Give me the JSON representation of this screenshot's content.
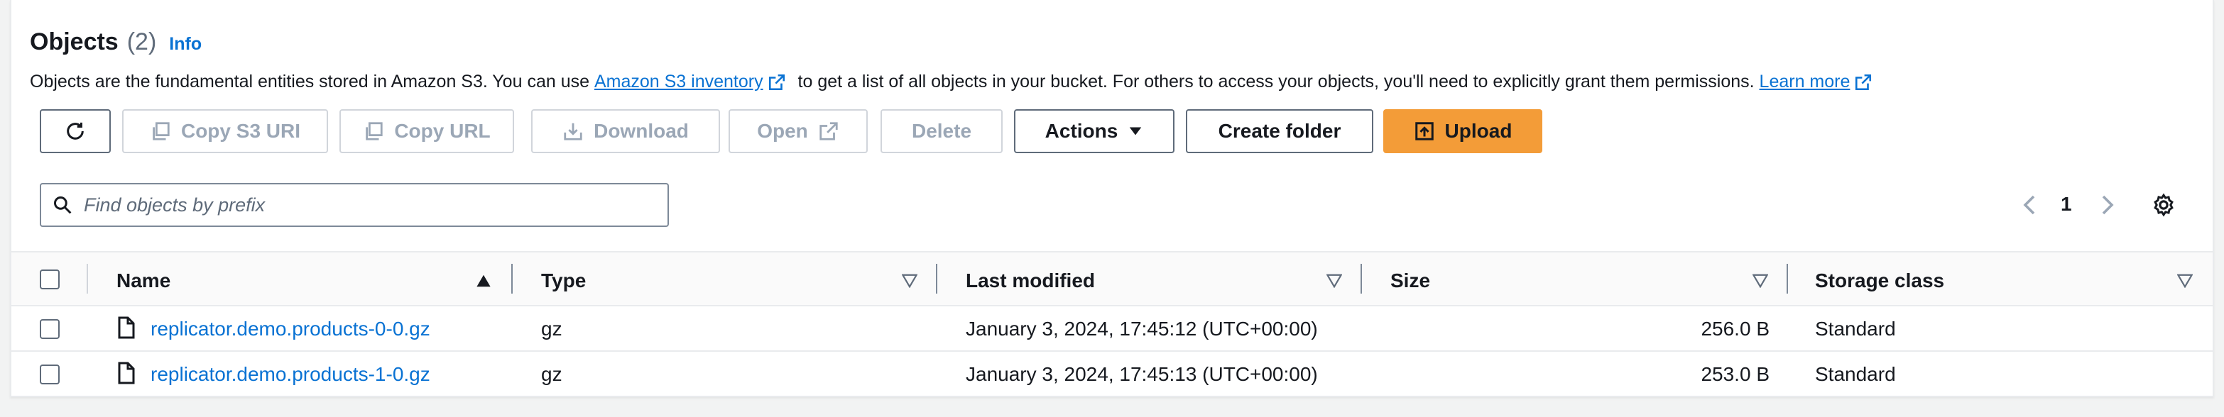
{
  "header": {
    "title": "Objects",
    "count": "(2)",
    "info": "Info"
  },
  "description": {
    "text_before": "Objects are the fundamental entities stored in Amazon S3. You can use ",
    "link_inventory": "Amazon S3 inventory",
    "text_middle": " to get a list of all objects in your bucket. For others to access your objects, you'll need to explicitly grant them permissions. ",
    "link_learn": "Learn more"
  },
  "toolbar": {
    "copy_s3_uri": "Copy S3 URI",
    "copy_url": "Copy URL",
    "download": "Download",
    "open": "Open",
    "delete": "Delete",
    "actions": "Actions",
    "create_folder": "Create folder",
    "upload": "Upload"
  },
  "search": {
    "placeholder": "Find objects by prefix",
    "value": ""
  },
  "pagination": {
    "current_page": "1"
  },
  "table": {
    "columns": [
      "Name",
      "Type",
      "Last modified",
      "Size",
      "Storage class"
    ],
    "rows": [
      {
        "name": "replicator.demo.products-0-0.gz",
        "type": "gz",
        "last_modified": "January 3, 2024, 17:45:12 (UTC+00:00)",
        "size": "256.0 B",
        "storage_class": "Standard"
      },
      {
        "name": "replicator.demo.products-1-0.gz",
        "type": "gz",
        "last_modified": "January 3, 2024, 17:45:13 (UTC+00:00)",
        "size": "253.0 B",
        "storage_class": "Standard"
      }
    ]
  },
  "colors": {
    "link": "#0972d3",
    "primary": "#f39c38",
    "disabled": "#9ba7b6",
    "text": "#16191f"
  },
  "icons": [
    "refresh-icon",
    "copy-icon",
    "download-icon",
    "external-link-icon",
    "caret-down-icon",
    "upload-icon",
    "search-icon",
    "chevron-left-icon",
    "chevron-right-icon",
    "settings-icon",
    "sort-asc-icon",
    "file-icon"
  ]
}
